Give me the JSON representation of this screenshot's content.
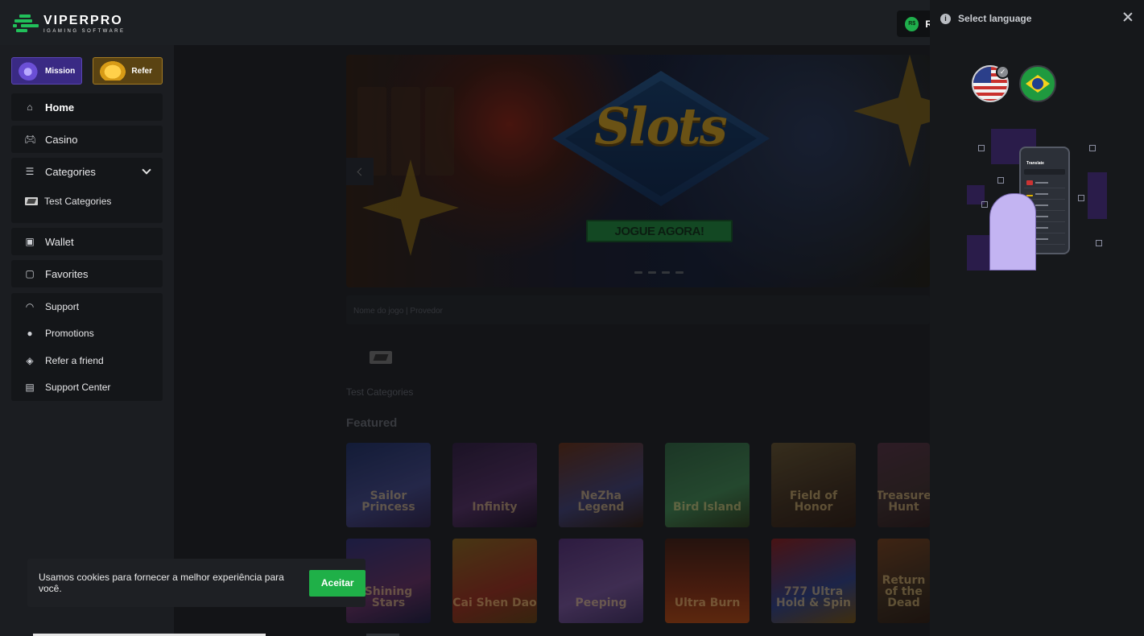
{
  "header": {
    "logo_title": "VIPERPRO",
    "logo_subtitle": "IGAMING SOFTWARE",
    "currency_badge": "R$",
    "balance_letter": "R"
  },
  "sidebar": {
    "mission_label": "Mission",
    "refer_label": "Refer",
    "nav": [
      {
        "label": "Home",
        "icon": "home-icon"
      },
      {
        "label": "Casino",
        "icon": "gamepad-icon"
      },
      {
        "label": "Categories",
        "icon": "list-icon"
      },
      {
        "label": "Test Categories",
        "icon": "category-thumb-icon"
      },
      {
        "label": "Wallet",
        "icon": "wallet-icon"
      },
      {
        "label": "Favorites",
        "icon": "folder-icon"
      }
    ],
    "support": [
      {
        "label": "Support",
        "icon": "headset-icon"
      },
      {
        "label": "Promotions",
        "icon": "megaphone-icon"
      },
      {
        "label": "Refer a friend",
        "icon": "ticket-icon"
      },
      {
        "label": "Support Center",
        "icon": "document-icon"
      }
    ]
  },
  "main": {
    "banner_title": "Slots",
    "banner_cta": "JOGUE AGORA!",
    "game_strip": "Nome do jogo | Provedor",
    "category_label": "Test Categories",
    "featured_title": "Featured",
    "games_row1": [
      "Sailor Princess",
      "Infinity",
      "NeZha Legend",
      "Bird Island",
      "Field of Honor",
      "Treasure Hunt"
    ],
    "games_row2": [
      "Shining Stars",
      "Cai Shen Dao",
      "Peeping",
      "Ultra Burn",
      "777 Ultra Hold & Spin",
      "Return of the Dead"
    ]
  },
  "cookie": {
    "text": "Usamos cookies para fornecer a melhor experiência para você.",
    "accept_label": "Aceitar"
  },
  "language_panel": {
    "title": "Select language",
    "options": [
      {
        "name": "English",
        "flag": "us-flag-icon",
        "selected": true
      },
      {
        "name": "Português",
        "flag": "brazil-flag-icon",
        "selected": false
      }
    ],
    "illustration_title": "Translate"
  },
  "colors": {
    "accent_green": "#1fb048",
    "mission_purple": "#3a2a84",
    "refer_gold": "#a47b23",
    "panel_bg": "#16181b"
  }
}
